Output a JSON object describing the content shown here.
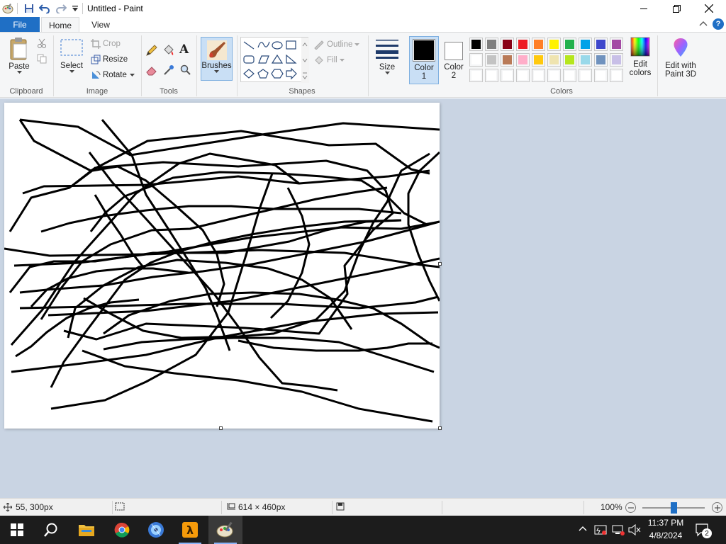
{
  "window": {
    "title": "Untitled - Paint",
    "qat_dropdown": "=",
    "controls": [
      "minimize-icon",
      "maximize-icon",
      "close-icon"
    ]
  },
  "tabs": {
    "file": "File",
    "home": "Home",
    "view": "View"
  },
  "ribbon": {
    "clipboard": {
      "label": "Clipboard",
      "paste": "Paste"
    },
    "image": {
      "label": "Image",
      "select": "Select",
      "crop": "Crop",
      "resize": "Resize",
      "rotate": "Rotate"
    },
    "tools": {
      "label": "Tools"
    },
    "brushes": {
      "label": "Brushes"
    },
    "shapes": {
      "label": "Shapes",
      "outline": "Outline",
      "fill": "Fill"
    },
    "size": {
      "label": "Size"
    },
    "color1": {
      "label": "Color",
      "num": "1",
      "value": "#000000"
    },
    "color2": {
      "label": "Color",
      "num": "2",
      "value": "#ffffff"
    },
    "colors": {
      "label": "Colors",
      "edit_colors_line1": "Edit",
      "edit_colors_line2": "colors",
      "paint3d_line1": "Edit with",
      "paint3d_line2": "Paint 3D",
      "palette_row1": [
        "#000000",
        "#7f7f7f",
        "#880015",
        "#ed1c24",
        "#ff7f27",
        "#fff200",
        "#22b14c",
        "#00a2e8",
        "#3f48cc",
        "#a349a4"
      ],
      "palette_row2": [
        "#ffffff",
        "#c3c3c3",
        "#b97a57",
        "#ffaec9",
        "#ffc90e",
        "#efe4b0",
        "#b5e61d",
        "#99d9ea",
        "#7092be",
        "#c8bfe7"
      ],
      "palette_row3": [
        "",
        "",
        "",
        "",
        "",
        "",
        "",
        "",
        "",
        ""
      ]
    }
  },
  "canvas": {
    "width": 614,
    "height": 460,
    "background": "#ffffff"
  },
  "statusbar": {
    "cursor_pos": "55, 300px",
    "image_size": "614 × 460px",
    "zoom": "100%"
  },
  "taskbar": {
    "apps": [
      "windows-start-icon",
      "search-icon",
      "file-explorer-icon",
      "chrome-icon",
      "media-app-icon",
      "half-life-icon",
      "paint-app-icon"
    ],
    "time": "11:37 PM",
    "date": "4/8/2024",
    "notification_count": "2"
  }
}
